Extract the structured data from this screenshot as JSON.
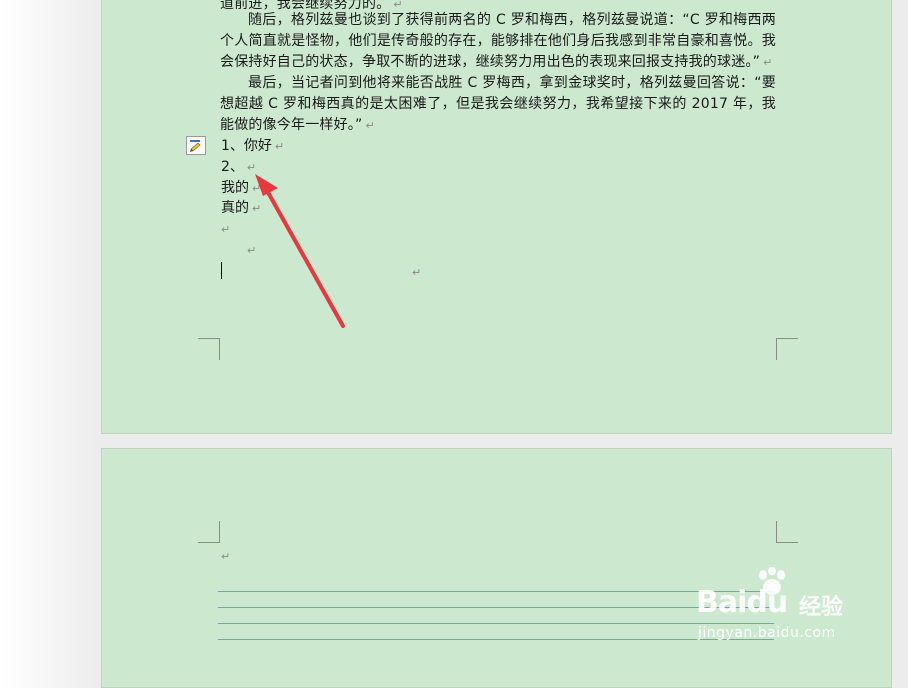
{
  "document": {
    "paragraphs": [
      {
        "text": "道前进，我会继续努力的。",
        "mark": "↵"
      },
      {
        "text": "随后，格列兹曼也谈到了获得前两名的 C 罗和梅西，格列兹曼说道：“C 罗和梅西两个人简直就是怪物，他们是传奇般的存在，能够排在他们身后我感到非常自豪和喜悦。我会保持好自己的状态，争取不断的进球，继续努力用出色的表现来回报支持我的球迷。”",
        "mark": "↵"
      },
      {
        "text": "最后，当记者问到他将来能否战胜 C 罗梅西，拿到金球奖时，格列兹曼回答说：“要想超越 C 罗和梅西真的是太困难了，但是我会继续努力，我希望接下来的 2017 年，我能做的像今年一样好。”",
        "mark": "↵"
      }
    ],
    "lines": [
      {
        "text": "1、你好",
        "mark": "↵"
      },
      {
        "text": "2、",
        "mark": "↵"
      },
      {
        "text": "我的",
        "mark": "↵"
      },
      {
        "text": "真的",
        "mark": "↵"
      },
      {
        "text": "",
        "mark": "↵"
      }
    ],
    "stray_marks": [
      "↵",
      "↵"
    ],
    "page2_mark": "↵"
  },
  "watermark": {
    "brand": "Baidu",
    "brand_cn": "经验",
    "url": "jingyan.baidu.com"
  },
  "colors": {
    "page_bg": "#cce8cf",
    "arrow": "#e8383d",
    "rule_line": "#6e9fd6"
  }
}
